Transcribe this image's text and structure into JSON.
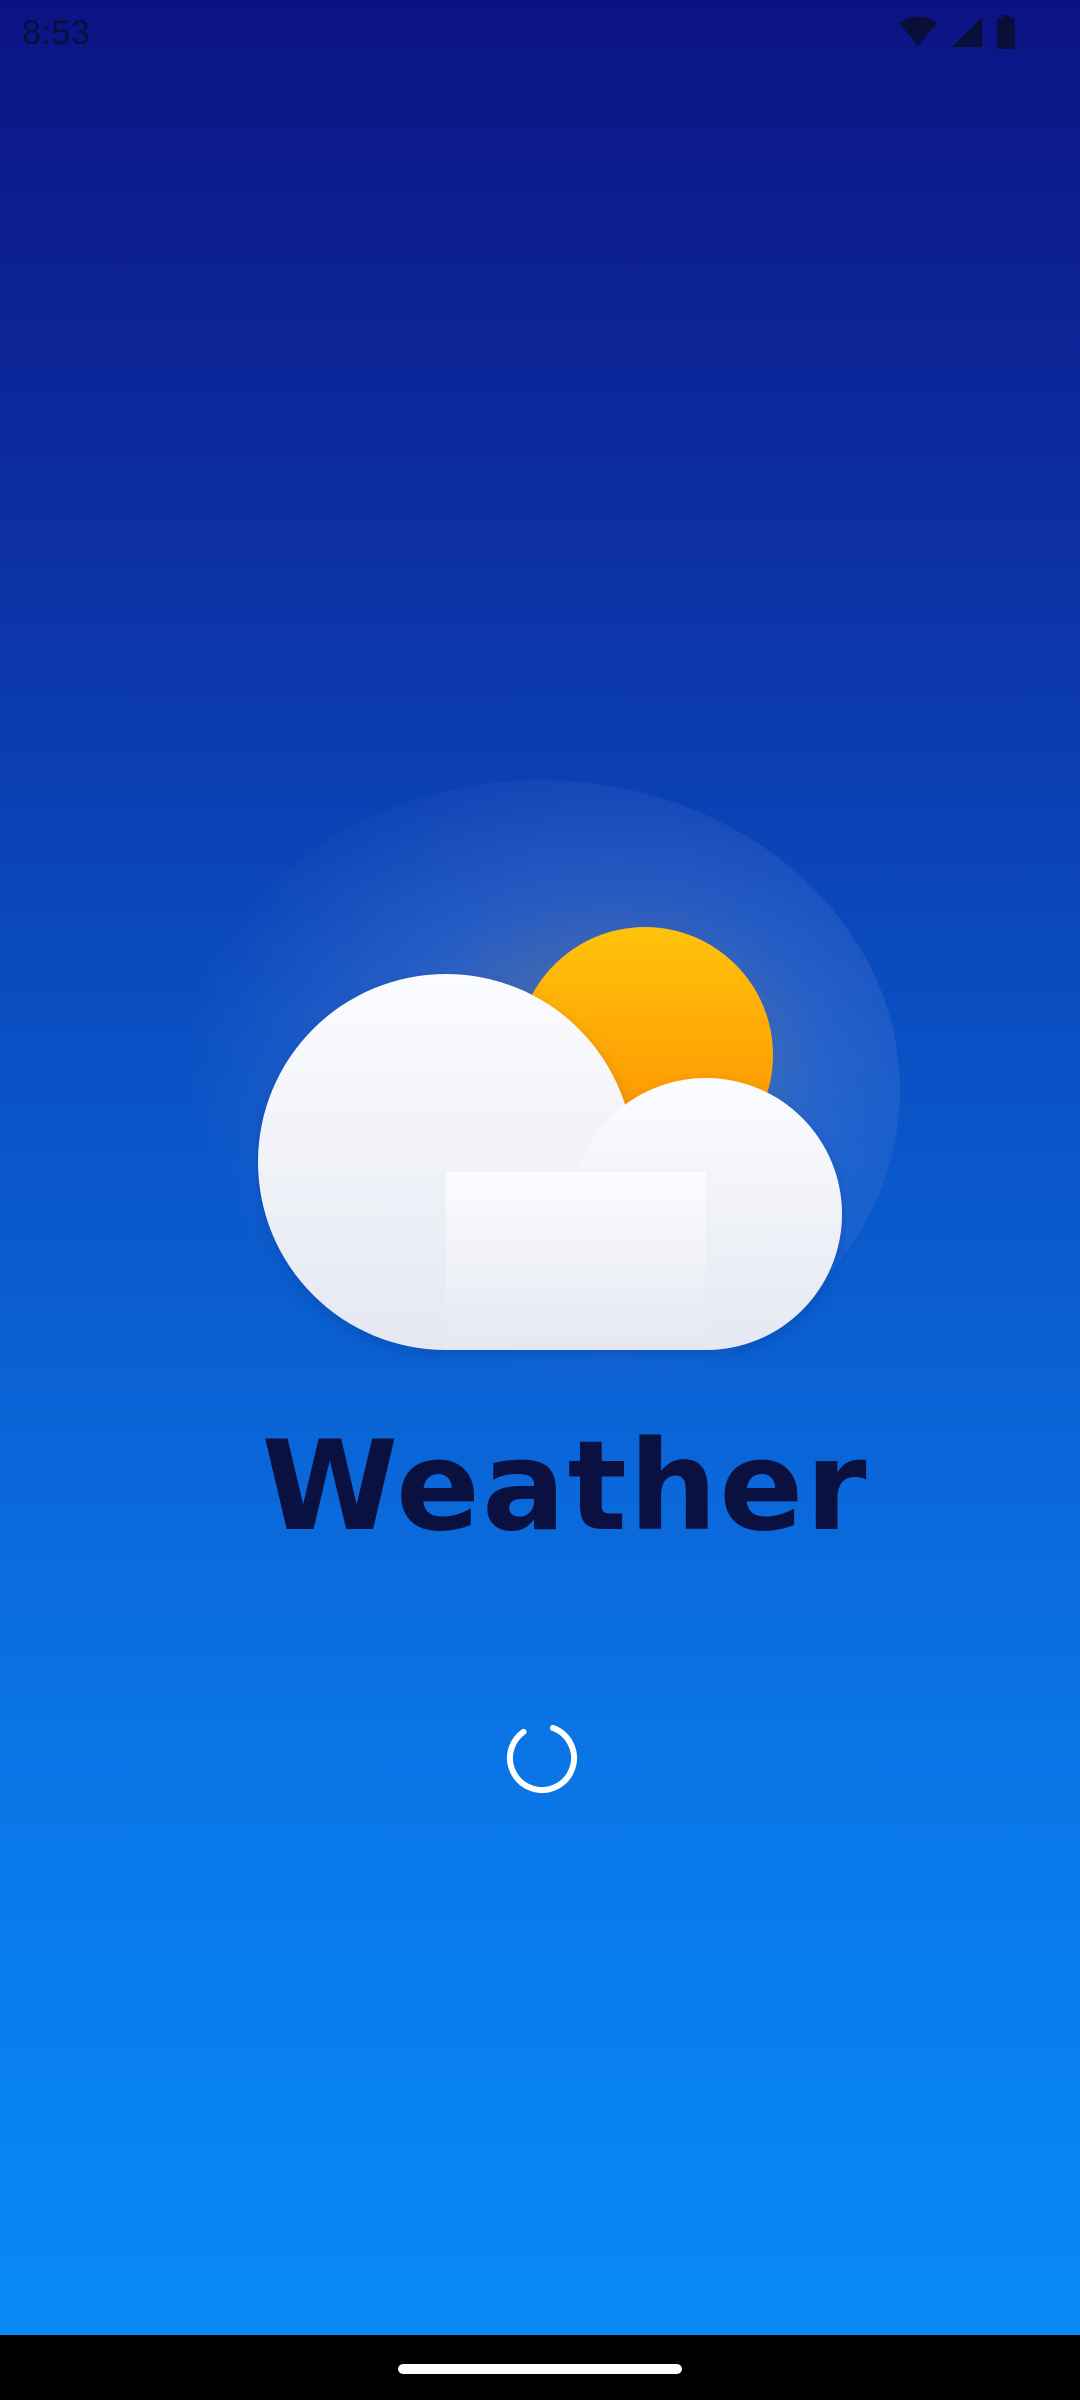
{
  "status_bar": {
    "time": "8:53",
    "icons": [
      "wifi-icon",
      "cellular-signal-icon",
      "battery-icon"
    ]
  },
  "splash": {
    "app_name": "Weather",
    "illustration": [
      "sun-icon",
      "cloud-icon"
    ],
    "loading": true
  },
  "colors": {
    "background_top": "#0b1384",
    "background_bottom": "#078cf9",
    "title": "#0a1140",
    "sun": "#ffa500",
    "cloud": "#eef0f7",
    "spinner": "#ffffff"
  }
}
